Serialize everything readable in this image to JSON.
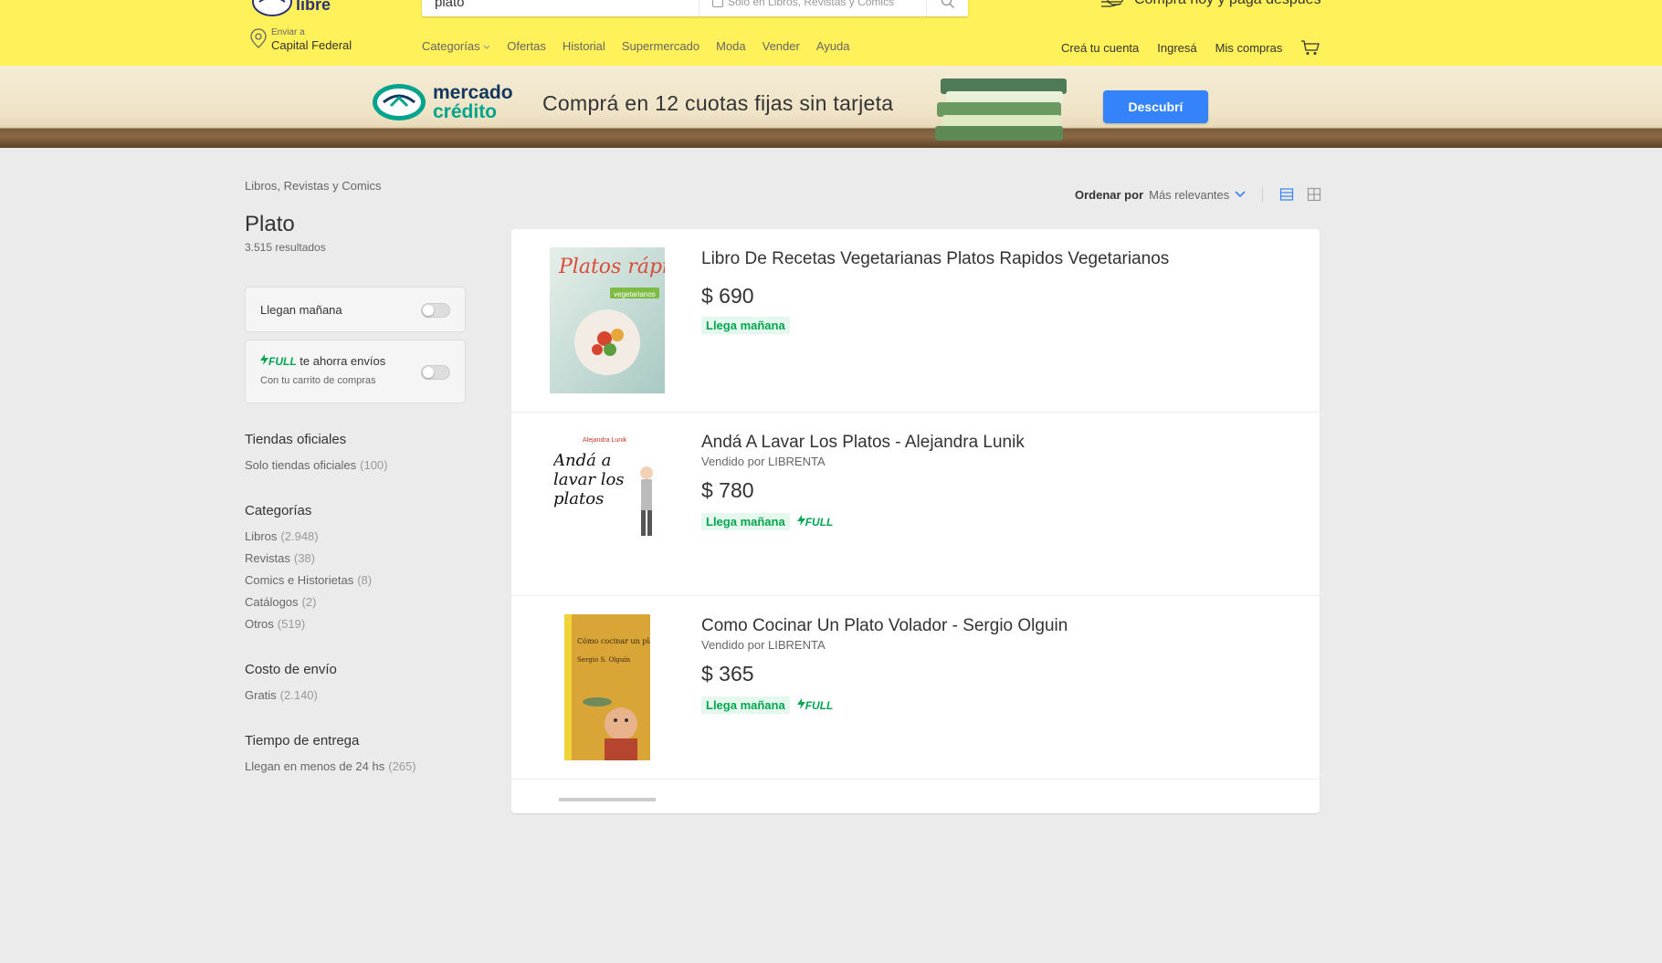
{
  "header": {
    "logo_text": "libre",
    "search_value": "plato",
    "search_scope": "Solo en Libros, Revistas y Comics",
    "promo": "Compra hoy y pagá después",
    "ship_label": "Enviar a",
    "ship_city": "Capital Federal",
    "nav": [
      "Categorías",
      "Ofertas",
      "Historial",
      "Supermercado",
      "Moda",
      "Vender",
      "Ayuda"
    ],
    "user_nav": [
      "Creá tu cuenta",
      "Ingresá",
      "Mis compras"
    ]
  },
  "banner": {
    "brand_top": "mercado",
    "brand_bottom": "crédito",
    "title": "Comprá en 12 cuotas fijas sin tarjeta",
    "cta": "Descubrí"
  },
  "breadcrumb": "Libros, Revistas y Comics",
  "page_title": "Plato",
  "results_count": "3.515 resultados",
  "toggles": {
    "llegan": "Llegan mañana",
    "full_brand": "FULL",
    "full_text": "te ahorra envíos",
    "full_sub": "Con tu carrito de compras"
  },
  "filters": [
    {
      "title": "Tiendas oficiales",
      "items": [
        {
          "label": "Solo tiendas oficiales",
          "count": "(100)"
        }
      ]
    },
    {
      "title": "Categorías",
      "items": [
        {
          "label": "Libros",
          "count": "(2.948)"
        },
        {
          "label": "Revistas",
          "count": "(38)"
        },
        {
          "label": "Comics e Historietas",
          "count": "(8)"
        },
        {
          "label": "Catálogos",
          "count": "(2)"
        },
        {
          "label": "Otros",
          "count": "(519)"
        }
      ]
    },
    {
      "title": "Costo de envío",
      "items": [
        {
          "label": "Gratis",
          "count": "(2.140)"
        }
      ]
    },
    {
      "title": "Tiempo de entrega",
      "items": [
        {
          "label": "Llegan en menos de 24 hs",
          "count": "(265)"
        }
      ]
    }
  ],
  "sort": {
    "label": "Ordenar por",
    "value": "Más relevantes"
  },
  "results": [
    {
      "title": "Libro De Recetas Vegetarianas Platos Rapidos Vegetarianos",
      "seller": "",
      "price": "$ 690",
      "badge": "Llega mañana",
      "full": "",
      "cover_text": "Platos rápidos",
      "cover_sub": "vegetarianos"
    },
    {
      "title": "Andá A Lavar Los Platos - Alejandra Lunik",
      "seller": "Vendido por LIBRENTA",
      "price": "$ 780",
      "badge": "Llega mañana",
      "full": "FULL",
      "cover_text": "Andá a lavar los platos",
      "cover_author": "Alejandra Lunik"
    },
    {
      "title": "Como Cocinar Un Plato Volador - Sergio Olguin",
      "seller": "Vendido por LIBRENTA",
      "price": "$ 365",
      "badge": "Llega mañana",
      "full": "FULL",
      "cover_text": "Cómo cocinar un plato volador",
      "cover_author": "Sergio S. Olguín"
    }
  ],
  "colors": {
    "header_bg": "#fff159",
    "accent_blue": "#3483fa",
    "full_green": "#00a650"
  }
}
